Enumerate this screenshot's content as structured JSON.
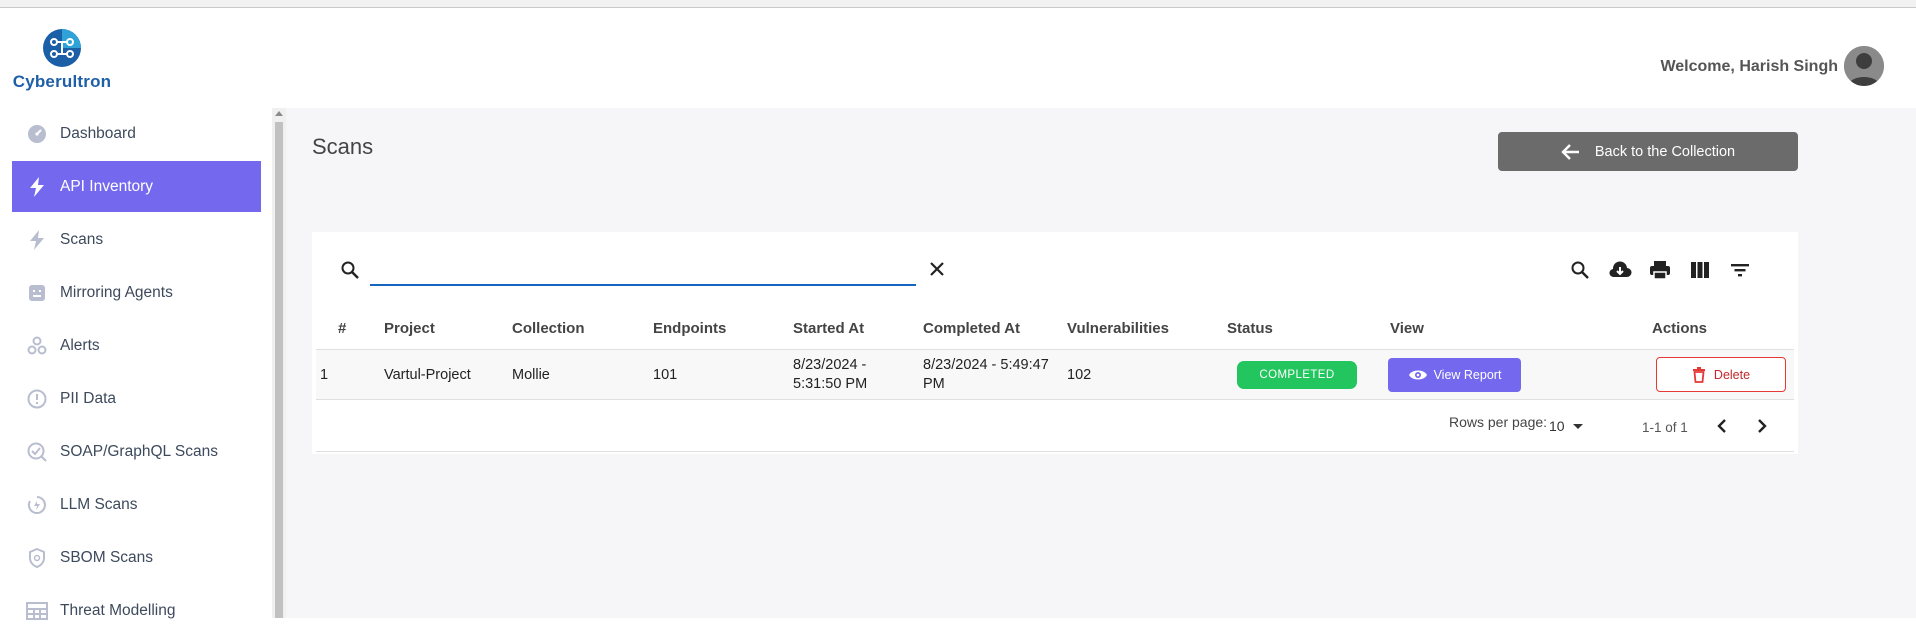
{
  "brand": {
    "name": "Cyberultron"
  },
  "header": {
    "welcome": "Welcome, Harish Singh"
  },
  "sidebar": {
    "items": [
      {
        "label": "Dashboard",
        "icon": "dashboard-icon"
      },
      {
        "label": "API Inventory",
        "icon": "bolt-icon",
        "active": true
      },
      {
        "label": "Scans",
        "icon": "bolt-icon"
      },
      {
        "label": "Mirroring Agents",
        "icon": "agent-icon"
      },
      {
        "label": "Alerts",
        "icon": "alerts-icon"
      },
      {
        "label": "PII Data",
        "icon": "info-icon"
      },
      {
        "label": "SOAP/GraphQL Scans",
        "icon": "check-search-icon"
      },
      {
        "label": "LLM Scans",
        "icon": "llm-icon"
      },
      {
        "label": "SBOM Scans",
        "icon": "shield-icon"
      },
      {
        "label": "Threat Modelling",
        "icon": "grid-icon"
      }
    ]
  },
  "main": {
    "title": "Scans",
    "back_button": "Back to the Collection"
  },
  "table": {
    "search_value": "",
    "columns": [
      "#",
      "Project",
      "Collection",
      "Endpoints",
      "Started At",
      "Completed At",
      "Vulnerabilities",
      "Status",
      "View",
      "Actions"
    ],
    "rows": [
      {
        "index": "1",
        "project": "Vartul-Project",
        "collection": "Mollie",
        "endpoints": "101",
        "started_line1": "8/23/2024 -",
        "started_line2": "5:31:50 PM",
        "completed_line1": "8/23/2024 - 5:49:47",
        "completed_line2": "PM",
        "vulnerabilities": "102",
        "status": "COMPLETED",
        "view_label": "View Report",
        "delete_label": "Delete"
      }
    ],
    "pagination": {
      "rows_per_page_label": "Rows per page:",
      "rows_per_page": "10",
      "range": "1-1 of 1"
    }
  },
  "colors": {
    "accent": "#7468ee",
    "status_completed": "#22c55e",
    "back_button": "#6b6b6b",
    "delete": "#e53935"
  }
}
